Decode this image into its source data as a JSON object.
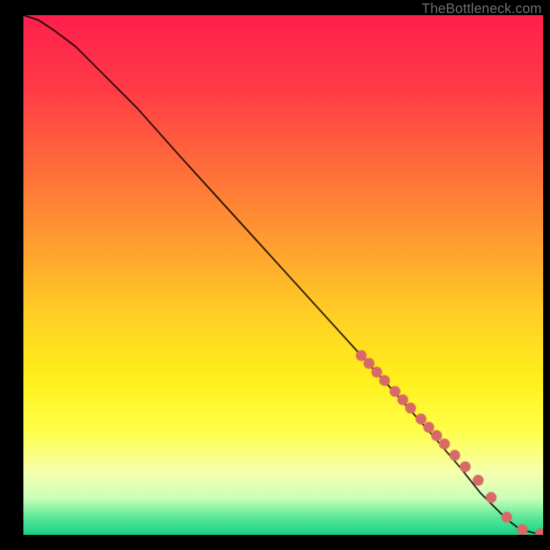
{
  "watermark": "TheBottleneck.com",
  "chart_data": {
    "type": "line",
    "title": "",
    "xlabel": "",
    "ylabel": "",
    "xlim": [
      0,
      100
    ],
    "ylim": [
      0,
      100
    ],
    "grid": false,
    "legend": false,
    "background_gradient_stops": [
      {
        "pos": 0.0,
        "color": "#ff1f4d"
      },
      {
        "pos": 0.14,
        "color": "#ff3b47"
      },
      {
        "pos": 0.3,
        "color": "#ff6f3a"
      },
      {
        "pos": 0.45,
        "color": "#ffa22f"
      },
      {
        "pos": 0.58,
        "color": "#ffd024"
      },
      {
        "pos": 0.7,
        "color": "#fff01c"
      },
      {
        "pos": 0.8,
        "color": "#ffff4a"
      },
      {
        "pos": 0.88,
        "color": "#f6ffb0"
      },
      {
        "pos": 0.93,
        "color": "#c9ffb8"
      },
      {
        "pos": 0.965,
        "color": "#5fe99a"
      },
      {
        "pos": 1.0,
        "color": "#17d087"
      }
    ],
    "series": [
      {
        "name": "curve",
        "color": "#000000",
        "line_width": 2,
        "x": [
          0,
          3,
          6,
          10,
          15,
          22,
          30,
          40,
          50,
          60,
          70,
          78,
          84,
          88,
          91,
          93,
          95,
          97,
          99,
          100
        ],
        "y": [
          100,
          99,
          97,
          94,
          89,
          82,
          73,
          62,
          51,
          40,
          29,
          20,
          13,
          8,
          5,
          3,
          1.5,
          0.7,
          0.2,
          0.1
        ]
      }
    ],
    "markers": {
      "name": "dots",
      "color": "#d86a66",
      "radius": 8,
      "x": [
        65,
        66.5,
        68,
        69.5,
        71.5,
        73,
        74.5,
        76.5,
        78,
        79.5,
        81,
        83,
        85,
        87.5,
        90,
        93,
        96,
        99.5
      ],
      "y": [
        34.5,
        33,
        31.3,
        29.7,
        27.6,
        26,
        24.4,
        22.3,
        20.7,
        19.1,
        17.5,
        15.3,
        13.1,
        10.5,
        7.2,
        3.4,
        1.0,
        0.2
      ]
    }
  }
}
